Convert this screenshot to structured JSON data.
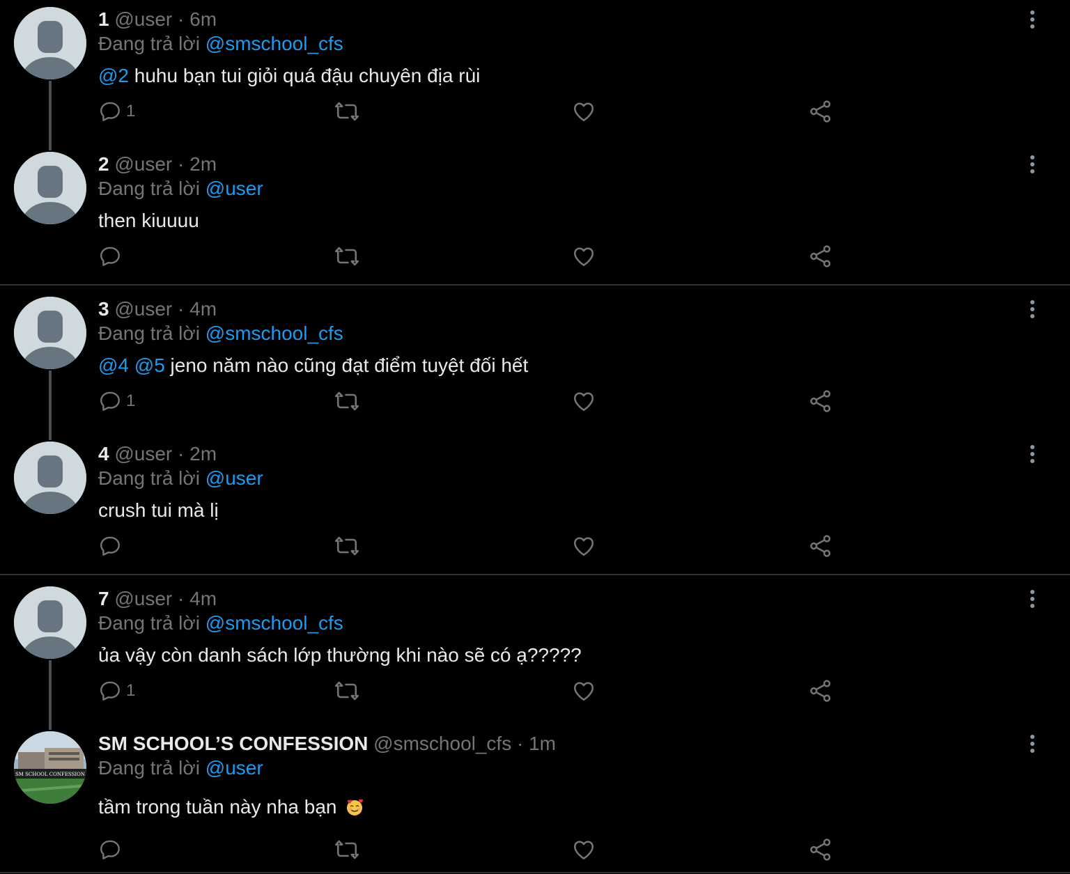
{
  "colors": {
    "background": "#000000",
    "text": "#e7e9ea",
    "muted": "#71767b",
    "link": "#1d9bf0",
    "divider": "#2f3336",
    "thread_line": "#4a4d52"
  },
  "replying_label": "Đang trả lời",
  "icons": {
    "reply": "reply-icon",
    "retweet": "retweet-icon",
    "like": "heart-icon",
    "share": "share-icon",
    "more": "more-options-icon",
    "body_emoji": "smiling-face-with-hearts-emoji"
  },
  "tweets": [
    {
      "name": "1",
      "handle": "@user",
      "sep": " · ",
      "time": "6m",
      "replying_to": "@smschool_cfs",
      "mentions": "@2",
      "text": " huhu bạn tui giỏi quá đậu chuyên địa rùi",
      "reply_count": "1"
    },
    {
      "name": "2",
      "handle": "@user",
      "sep": " · ",
      "time": "2m",
      "replying_to": "@user",
      "text": "then kiuuuu"
    },
    {
      "name": "3",
      "handle": "@user",
      "sep": " · ",
      "time": "4m",
      "replying_to": "@smschool_cfs",
      "mentions": "@4 @5",
      "text": " jeno năm nào cũng đạt điểm tuyệt đối hết",
      "reply_count": "1"
    },
    {
      "name": "4",
      "handle": "@user",
      "sep": " · ",
      "time": "2m",
      "replying_to": "@user",
      "text": "crush tui mà lị"
    },
    {
      "name": "7",
      "handle": "@user",
      "sep": " · ",
      "time": "4m",
      "replying_to": "@smschool_cfs",
      "text": "ủa vậy còn danh sách lớp thường khi nào sẽ có ạ?????",
      "reply_count": "1"
    },
    {
      "name": "SM SCHOOL’S CONFESSION",
      "handle": "@smschool_cfs",
      "sep": " · ",
      "time": "1m",
      "replying_to": "@user",
      "text": "tầm trong tuần này nha bạn",
      "avatar_text": "SM SCHOOL CONFESSION"
    }
  ]
}
